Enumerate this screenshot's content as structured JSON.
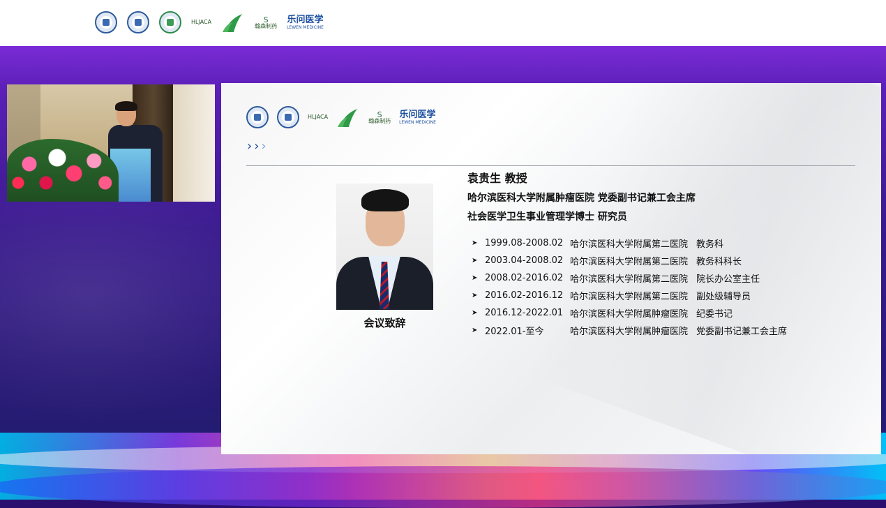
{
  "header": {
    "logos": [
      {
        "icon": "university-seal-icon"
      },
      {
        "icon": "hospital-seal-icon"
      },
      {
        "icon": "green-seal-icon"
      },
      {
        "icon": "association-wheat-logo-icon",
        "text": "HLJACA"
      },
      {
        "icon": "leaf-logo-icon"
      },
      {
        "icon": "pharma-logo-icon",
        "text": "翰森制药"
      },
      {
        "icon": "lewen-medicine-logo-icon",
        "text": "乐问医学",
        "subtext": "LEWEN MEDICINE"
      }
    ]
  },
  "slide": {
    "speaker_name": "袁贵生  教授",
    "positions": [
      "哈尔滨医科大学附属肿瘤医院  党委副书记兼工会主席",
      "社会医学卫生事业管理学博士  研究员"
    ],
    "photo_caption": "会议致辞",
    "timeline": [
      {
        "period": "1999.08-2008.02",
        "org": "哈尔滨医科大学附属第二医院",
        "role": "教务科"
      },
      {
        "period": "2003.04-2008.02",
        "org": "哈尔滨医科大学附属第二医院",
        "role": "教务科科长"
      },
      {
        "period": "2008.02-2016.02",
        "org": "哈尔滨医科大学附属第二医院",
        "role": "院长办公室主任"
      },
      {
        "period": "2016.02-2016.12",
        "org": "哈尔滨医科大学附属第二医院",
        "role": "副处级辅导员"
      },
      {
        "period": "2016.12-2022.01",
        "org": "哈尔滨医科大学附属肿瘤医院",
        "role": "纪委书记"
      },
      {
        "period": "2022.01-至今",
        "org": "哈尔滨医科大学附属肿瘤医院",
        "role": "党委副书记兼工会主席"
      }
    ],
    "bullet_glyph": "➤",
    "arrow_glyph": "›"
  },
  "video": {
    "icon": "speaker-video-feed"
  },
  "colors": {
    "accent": "#1f4fa0",
    "background_top": "#7a2bd6",
    "background_bottom": "#1d1e6a"
  }
}
